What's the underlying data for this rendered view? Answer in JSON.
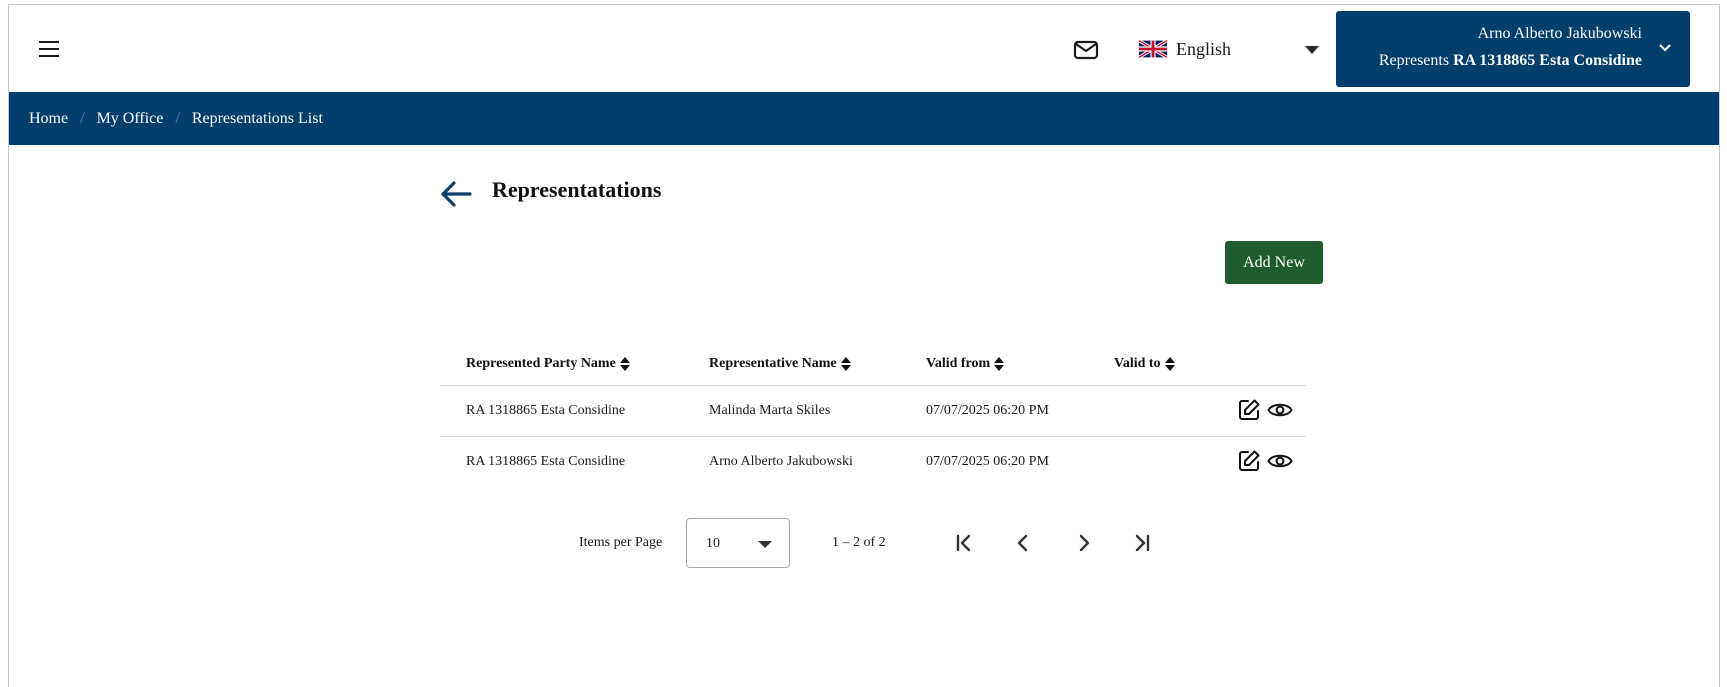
{
  "header": {
    "menu_icon": "hamburger-menu-icon",
    "mail_icon": "envelope-icon",
    "language": {
      "flag_icon": "uk-flag-icon",
      "label": "English"
    },
    "user": {
      "name": "Arno Alberto Jakubowski",
      "represents_prefix": "Represents",
      "represents_entity": "RA 1318865 Esta Considine"
    }
  },
  "breadcrumb": [
    {
      "label": "Home"
    },
    {
      "label": "My Office"
    },
    {
      "label": "Representations List"
    }
  ],
  "page": {
    "title": "Representatations",
    "add_button": "Add New"
  },
  "table": {
    "columns": [
      "Represented Party Name",
      "Representative Name",
      "Valid from",
      "Valid to"
    ],
    "rows": [
      {
        "party": "RA 1318865 Esta Considine",
        "representative": "Malinda Marta Skiles",
        "valid_from": "07/07/2025 06:20 PM",
        "valid_to": ""
      },
      {
        "party": "RA 1318865 Esta Considine",
        "representative": "Arno Alberto Jakubowski",
        "valid_from": "07/07/2025 06:20 PM",
        "valid_to": ""
      }
    ]
  },
  "paginator": {
    "items_per_page_label": "Items per Page",
    "items_per_page_value": "10",
    "range_label": "1 – 2 of 2"
  },
  "colors": {
    "brand_navy": "#003e6b",
    "button_green": "#1e5c2e"
  }
}
